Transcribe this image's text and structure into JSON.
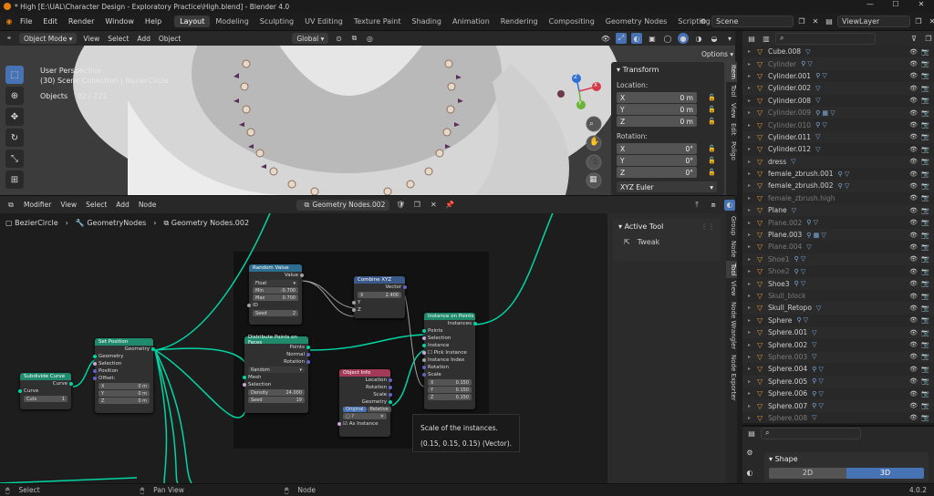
{
  "window": {
    "title": "* High [E:\\UAL\\Character Design - Exploratory Practice\\High.blend] - Blender 4.0"
  },
  "menu": {
    "items": [
      "File",
      "Edit",
      "Render",
      "Window",
      "Help"
    ]
  },
  "workspaces": {
    "tabs": [
      "Layout",
      "Modeling",
      "Sculpting",
      "UV Editing",
      "Texture Paint",
      "Shading",
      "Animation",
      "Rendering",
      "Compositing",
      "Geometry Nodes",
      "Scripting"
    ],
    "active": "Layout"
  },
  "scene": {
    "name": "Scene",
    "view_layer": "ViewLayer"
  },
  "viewport": {
    "mode": "Object Mode",
    "menus": [
      "View",
      "Select",
      "Add",
      "Object"
    ],
    "orientation": "Global",
    "options_label": "Options",
    "info": {
      "view": "User Perspective",
      "collection": "(30) Scene Collection | BezierCircle",
      "objects_label": "Objects",
      "objects_count": "92 / 221"
    },
    "gizmo_labels": {
      "x": "X",
      "y": "Y",
      "z": "Z"
    }
  },
  "transform_panel": {
    "title": "Transform",
    "location_label": "Location:",
    "location": [
      {
        "axis": "X",
        "value": "0 m"
      },
      {
        "axis": "Y",
        "value": "0 m"
      },
      {
        "axis": "Z",
        "value": "0 m"
      }
    ],
    "rotation_label": "Rotation:",
    "rotation": [
      {
        "axis": "X",
        "value": "0°"
      },
      {
        "axis": "Y",
        "value": "0°"
      },
      {
        "axis": "Z",
        "value": "0°"
      }
    ],
    "rotation_mode": "XYZ Euler"
  },
  "viewport_tabs": [
    "Item",
    "Tool",
    "View",
    "Edit",
    "Poligo"
  ],
  "node_editor": {
    "editor_type": "Modifier",
    "menus": [
      "View",
      "Select",
      "Add",
      "Node"
    ],
    "tree_name": "Geometry Nodes.002",
    "breadcrumb": [
      "BezierCircle",
      "GeometryNodes",
      "Geometry Nodes.002"
    ]
  },
  "nodes": {
    "random_value": {
      "title": "Random Value",
      "out": "Value",
      "type": "Float",
      "min_label": "Min",
      "min": "-0.700",
      "max_label": "Max",
      "max": "0.700",
      "id": "ID",
      "seed_label": "Seed",
      "seed": "2"
    },
    "combine_xyz": {
      "title": "Combine XYZ",
      "out": "Vector",
      "x_label": "X",
      "x": "2.400",
      "y": "Y",
      "z": "Z"
    },
    "instance_on_points": {
      "title": "Instance on Points",
      "out": "Instances",
      "points": "Points",
      "selection": "Selection",
      "instance": "Instance",
      "pick": "Pick Instance",
      "index": "Instance Index",
      "rotation": "Rotation",
      "scale": "Scale",
      "sx_label": "X",
      "sx": "0.150",
      "sy_label": "Y",
      "sy": "0.150",
      "sz_label": "Z",
      "sz": "0.150"
    },
    "distribute": {
      "title": "Distribute Points on Faces",
      "out1": "Points",
      "out2": "Normal",
      "out3": "Rotation",
      "mode": "Random",
      "mesh": "Mesh",
      "selection": "Selection",
      "density_label": "Density",
      "density": "24.000",
      "seed_label": "Seed",
      "seed": "19"
    },
    "object_info": {
      "title": "Object Info",
      "location": "Location",
      "rotation": "Rotation",
      "scale": "Scale",
      "geometry": "Geometry",
      "original": "Original",
      "relative": "Relative",
      "object": "?",
      "as_instance": "As Instance"
    },
    "set_position": {
      "title": "Set Position",
      "out": "Geometry",
      "geometry": "Geometry",
      "selection": "Selection",
      "position": "Position",
      "offset": "Offset:",
      "x_label": "X",
      "x": "0 m",
      "y_label": "Y",
      "y": "0 m",
      "z_label": "Z",
      "z": "0 m"
    },
    "subdivide": {
      "title": "Subdivide Curve",
      "out": "Curve",
      "curve": "Curve",
      "cuts_label": "Cuts",
      "cuts": "1"
    }
  },
  "tooltip": {
    "line1": "Scale of the instances.",
    "line2": "(0.15, 0.15, 0.15) (Vector)."
  },
  "side_panel": {
    "title": "Active Tool",
    "tool": "Tweak"
  },
  "node_tabs": [
    "Group",
    "Node",
    "Tool",
    "View",
    "Node Wrangler",
    "Node Exporter"
  ],
  "outliner": {
    "items": [
      {
        "name": "Cube.008",
        "dim": false,
        "mods": "▽"
      },
      {
        "name": "Cylinder",
        "dim": true,
        "mods": "⚲ ▽"
      },
      {
        "name": "Cylinder.001",
        "dim": false,
        "mods": "⚲ ▽"
      },
      {
        "name": "Cylinder.002",
        "dim": false,
        "mods": "▽"
      },
      {
        "name": "Cylinder.008",
        "dim": false,
        "mods": "▽"
      },
      {
        "name": "Cylinder.009",
        "dim": true,
        "mods": "⚲ ▦ ▽"
      },
      {
        "name": "Cylinder.010",
        "dim": true,
        "mods": "⚲ ▽"
      },
      {
        "name": "Cylinder.011",
        "dim": false,
        "mods": "▽"
      },
      {
        "name": "Cylinder.012",
        "dim": false,
        "mods": "▽"
      },
      {
        "name": "dress",
        "dim": false,
        "mods": "▽"
      },
      {
        "name": "female_zbrush.001",
        "dim": false,
        "mods": "⚲ ▽"
      },
      {
        "name": "female_zbrush.002",
        "dim": false,
        "mods": "⚲ ▽"
      },
      {
        "name": "female_zbrush.high",
        "dim": true,
        "mods": ""
      },
      {
        "name": "Plane",
        "dim": false,
        "mods": "▽"
      },
      {
        "name": "Plane.002",
        "dim": true,
        "mods": "⚲ ▽"
      },
      {
        "name": "Plane.003",
        "dim": false,
        "mods": "⚲ ▦ ▽"
      },
      {
        "name": "Plane.004",
        "dim": true,
        "mods": "▽"
      },
      {
        "name": "Shoe1",
        "dim": true,
        "mods": "⚲ ▽"
      },
      {
        "name": "Shoe2",
        "dim": true,
        "mods": "⚲ ▽"
      },
      {
        "name": "Shoe3",
        "dim": false,
        "mods": "⚲ ▽"
      },
      {
        "name": "Skull_block",
        "dim": true,
        "mods": ""
      },
      {
        "name": "Skull_Retopo",
        "dim": false,
        "mods": "▽"
      },
      {
        "name": "Sphere",
        "dim": false,
        "mods": "⚲ ▽"
      },
      {
        "name": "Sphere.001",
        "dim": false,
        "mods": "▽"
      },
      {
        "name": "Sphere.002",
        "dim": false,
        "mods": "▽"
      },
      {
        "name": "Sphere.003",
        "dim": true,
        "mods": "▽"
      },
      {
        "name": "Sphere.004",
        "dim": false,
        "mods": "⚲ ▽"
      },
      {
        "name": "Sphere.005",
        "dim": false,
        "mods": "⚲ ▽"
      },
      {
        "name": "Sphere.006",
        "dim": false,
        "mods": "⚲ ▽"
      },
      {
        "name": "Sphere.007",
        "dim": false,
        "mods": "⚲ ▽"
      },
      {
        "name": "Sphere.008",
        "dim": true,
        "mods": "▽"
      }
    ]
  },
  "properties": {
    "section": "Shape",
    "opt_2d": "2D",
    "opt_3d": "3D"
  },
  "statusbar": {
    "select": "Select",
    "pan": "Pan View",
    "node": "Node",
    "version": "4.0.2"
  },
  "colors": {
    "accent": "#4772b3",
    "geometry_socket": "#00d6a3",
    "orange": "#e87d0d"
  }
}
